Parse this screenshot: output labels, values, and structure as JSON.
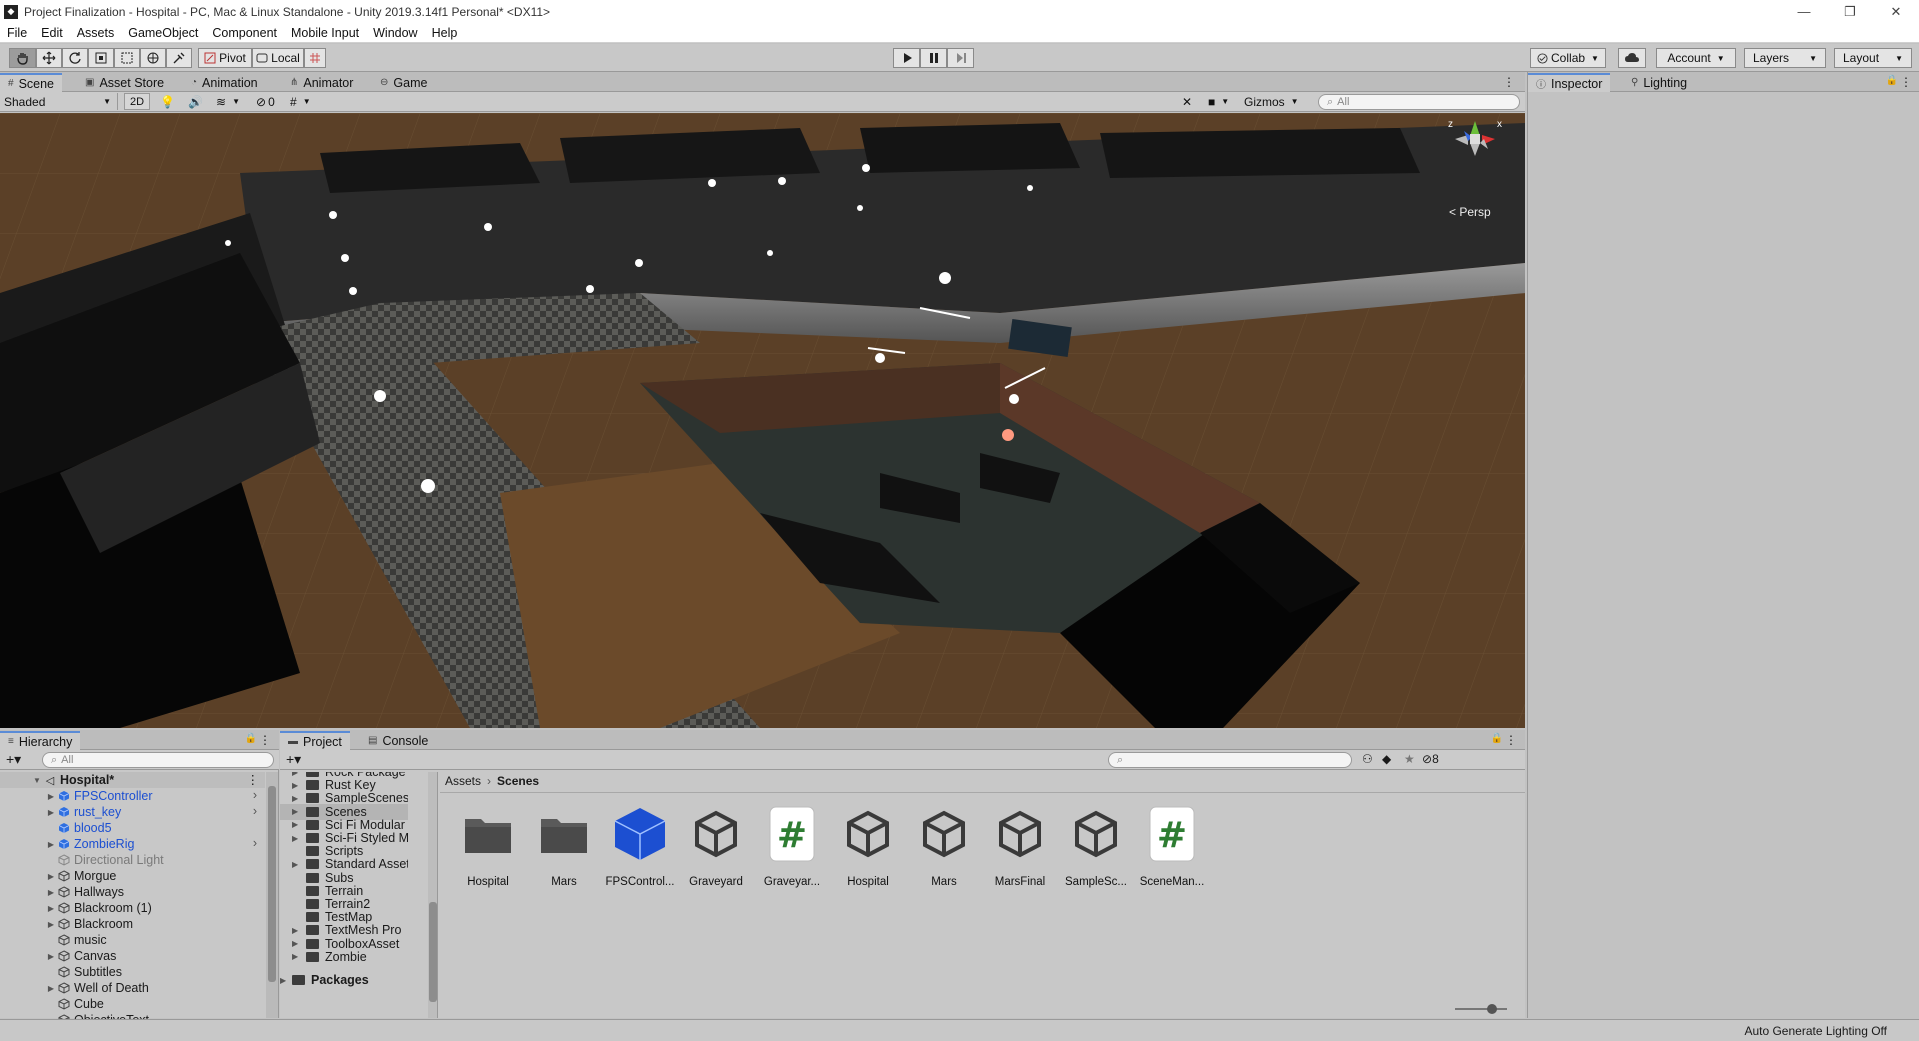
{
  "window": {
    "title": "Project Finalization - Hospital - PC, Mac & Linux Standalone - Unity 2019.3.14f1 Personal* <DX11>",
    "minimize": "—",
    "restore": "❐",
    "close": "✕"
  },
  "menu": [
    "File",
    "Edit",
    "Assets",
    "GameObject",
    "Component",
    "Mobile Input",
    "Window",
    "Help"
  ],
  "toolbar": {
    "pivot": "Pivot",
    "local": "Local",
    "collab": "Collab",
    "account": "Account",
    "layers": "Layers",
    "layout": "Layout"
  },
  "scene_tabs": [
    "Scene",
    "Asset Store",
    "Animation",
    "Animator",
    "Game"
  ],
  "scene_options": {
    "shading_mode": "Shaded",
    "mode_2d": "2D",
    "hidden_count": "0",
    "gizmos": "Gizmos",
    "search_placeholder": "All"
  },
  "gizmo": {
    "x": "x",
    "y": "y",
    "z": "z",
    "projection": "< Persp"
  },
  "inspector_tabs": [
    "Inspector",
    "Lighting"
  ],
  "hierarchy": {
    "tab": "Hierarchy",
    "search_placeholder": "All",
    "scene_name": "Hospital*",
    "items": [
      {
        "label": "FPSController",
        "style": "prefab",
        "expandable": true
      },
      {
        "label": "rust_key",
        "style": "prefab",
        "expandable": true
      },
      {
        "label": "blood5",
        "style": "prefab",
        "expandable": false
      },
      {
        "label": "ZombieRig",
        "style": "prefab",
        "expandable": true
      },
      {
        "label": "Directional Light",
        "style": "disabled",
        "expandable": false
      },
      {
        "label": "Morgue",
        "style": "normal",
        "expandable": true
      },
      {
        "label": "Hallways",
        "style": "normal",
        "expandable": true
      },
      {
        "label": "Blackroom (1)",
        "style": "normal",
        "expandable": true
      },
      {
        "label": "Blackroom",
        "style": "normal",
        "expandable": true
      },
      {
        "label": "music",
        "style": "normal",
        "expandable": false
      },
      {
        "label": "Canvas",
        "style": "normal",
        "expandable": true
      },
      {
        "label": "Subtitles",
        "style": "normal",
        "expandable": false
      },
      {
        "label": "Well of Death",
        "style": "normal",
        "expandable": true
      },
      {
        "label": "Cube",
        "style": "normal",
        "expandable": false
      },
      {
        "label": "ObjectiveText",
        "style": "normal",
        "expandable": false
      }
    ]
  },
  "project": {
    "tabs": [
      "Project",
      "Console"
    ],
    "hidden_count": "8",
    "folders": [
      {
        "label": "Rock Package",
        "expandable": true
      },
      {
        "label": "Rust Key",
        "expandable": true
      },
      {
        "label": "SampleScenes",
        "expandable": true
      },
      {
        "label": "Scenes",
        "expandable": true,
        "selected": true
      },
      {
        "label": "Sci Fi Modular Pa",
        "expandable": true
      },
      {
        "label": "Sci-Fi Styled Mod",
        "expandable": true
      },
      {
        "label": "Scripts",
        "expandable": false
      },
      {
        "label": "Standard Assets",
        "expandable": true
      },
      {
        "label": "Subs",
        "expandable": false
      },
      {
        "label": "Terrain",
        "expandable": false
      },
      {
        "label": "Terrain2",
        "expandable": false
      },
      {
        "label": "TestMap",
        "expandable": false
      },
      {
        "label": "TextMesh Pro",
        "expandable": true
      },
      {
        "label": "ToolboxAsset",
        "expandable": true
      },
      {
        "label": "Zombie",
        "expandable": true
      }
    ],
    "packages": "Packages",
    "breadcrumb": [
      "Assets",
      "Scenes"
    ],
    "assets": [
      {
        "label": "Hospital",
        "kind": "folder"
      },
      {
        "label": "Mars",
        "kind": "folder"
      },
      {
        "label": "FPSControl...",
        "kind": "prefab"
      },
      {
        "label": "Graveyard",
        "kind": "unity-scene"
      },
      {
        "label": "Graveyar...",
        "kind": "script"
      },
      {
        "label": "Hospital",
        "kind": "unity-scene"
      },
      {
        "label": "Mars",
        "kind": "unity-scene"
      },
      {
        "label": "MarsFinal",
        "kind": "unity-scene"
      },
      {
        "label": "SampleSc...",
        "kind": "unity-scene"
      },
      {
        "label": "SceneMan...",
        "kind": "script"
      }
    ]
  },
  "status": {
    "text": "Auto Generate Lighting Off"
  },
  "colors": {
    "script_hash": "#2e7d32",
    "prefab_blue": "#1c4fd1",
    "tab_accent": "#5a8bd6",
    "ground": "#5a3f26"
  }
}
